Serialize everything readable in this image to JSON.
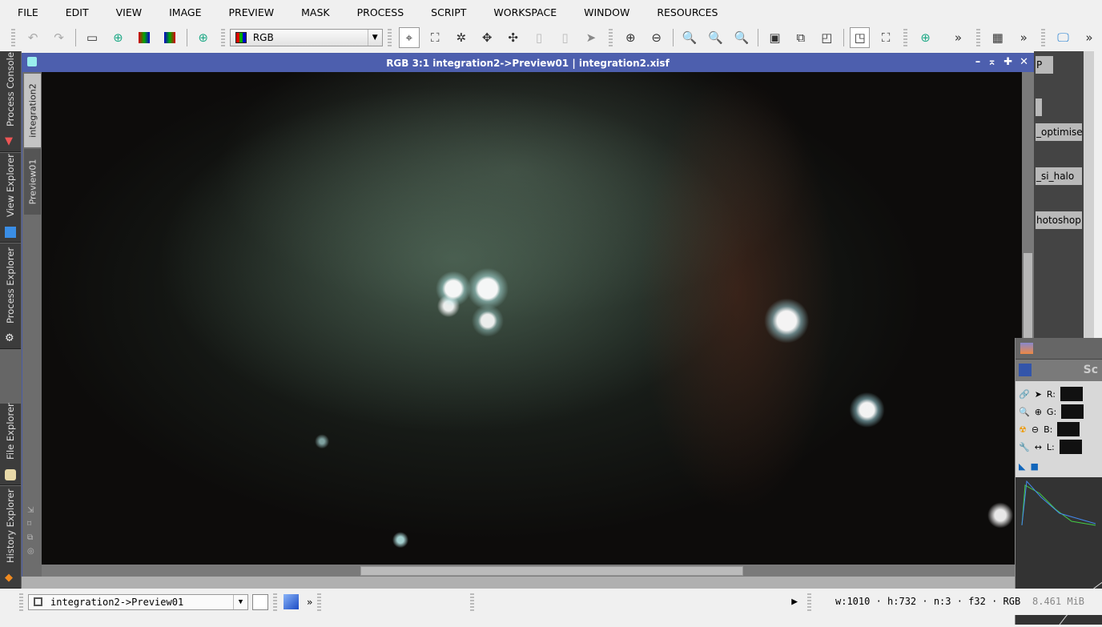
{
  "menu": [
    "FILE",
    "EDIT",
    "VIEW",
    "IMAGE",
    "PREVIEW",
    "MASK",
    "PROCESS",
    "SCRIPT",
    "WORKSPACE",
    "WINDOW",
    "RESOURCES"
  ],
  "toolbar": {
    "color_mode": "RGB",
    "overflow": "»"
  },
  "left_dock": [
    "Process Console",
    "View Explorer",
    "Process Explorer",
    "File Explorer",
    "History Explorer"
  ],
  "document": {
    "title": "RGB 3:1 integration2->Preview01 | integration2.xisf",
    "tabs": [
      "integration2",
      "Preview01"
    ]
  },
  "right_dock": {
    "icons": [
      "P",
      "_optimise_",
      "_si_halo",
      "hotoshop"
    ]
  },
  "histogram": {
    "title": "Sc",
    "channels": [
      "R:",
      "G:",
      "B:",
      "L:"
    ]
  },
  "statusbar": {
    "view": "integration2->Preview01",
    "info": "w:1010 · h:732 · n:3 · f32 · RGB",
    "size": "8.461 MiB",
    "overflow": "»"
  }
}
